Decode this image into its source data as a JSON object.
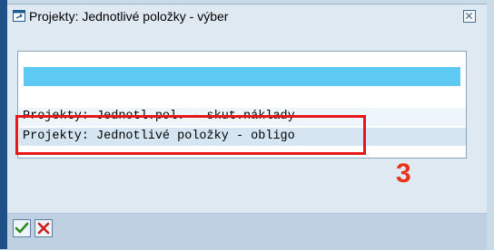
{
  "dialog": {
    "title": "Projekty: Jednotlivé položky - výber",
    "icons": {
      "title": "dialog-window-icon",
      "close": "close-icon",
      "confirm": "checkmark-icon",
      "cancel": "cancel-icon"
    }
  },
  "list": {
    "items": [
      {
        "label": "Projekty: Jednotl.pol. - skut.náklady",
        "selected": false
      },
      {
        "label": "Projekty: Jednotlivé položky - obligo",
        "selected": true
      }
    ]
  },
  "annotation": {
    "step": "3",
    "color": "#e51818"
  },
  "colors": {
    "header_bar": "#5ec9f3",
    "selected_row": "#d5e6f2"
  }
}
